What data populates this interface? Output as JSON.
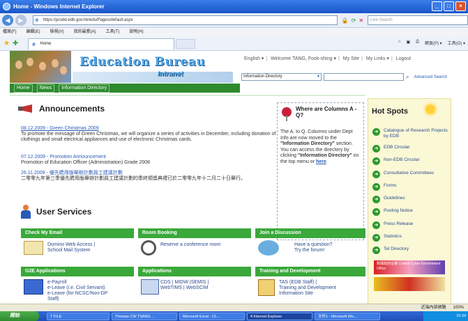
{
  "window": {
    "title": "Home - Windows Internet Explorer",
    "address": "https://pcsbd.edb.gov.hk/edu/Pages/default.aspx",
    "live_search": "Live Search",
    "tab_label": "Home"
  },
  "menu": [
    "檔案(F)",
    "編輯(E)",
    "檢視(V)",
    "我的最愛(A)",
    "工具(T)",
    "說明(H)"
  ],
  "command_bar": [
    "網頁(P) ▾",
    "工具(O) ▾"
  ],
  "site": {
    "title_line1": "Education Bureau",
    "title_line2": "Intranet",
    "nav_tabs": [
      "Home",
      "News",
      "Information Directory"
    ],
    "top_links": [
      "English ▾",
      "Welcome TANG, Fook-shing ▾",
      "My Site",
      "My Links ▾",
      "Logout"
    ],
    "search_scope": "Information Directory",
    "advanced_search": "Advanced Search"
  },
  "announcements": {
    "heading": "Announcements",
    "items": [
      {
        "date_title": "08.12.2009 - Green Christmas 2009",
        "body": "To promote the message of Green Christmas, we will organize a series of activities in December, including donation of clothings and small electrical appliances and use of electronic Christmas cards."
      },
      {
        "date_title": "07.12.2009 - Promotion Announcement",
        "body": "Promotion of Education Officer (Administration) Grade 2008"
      },
      {
        "date_title": "26.11.2009 - 優先聘用版舉辦計劃員工建議計劃",
        "body": "二零零九年第三季優先聘用版舉辦計劃員工建議計劃的季終頒獎典禮已於二零零九年十二月二十日舉行。"
      }
    ]
  },
  "where_are": {
    "heading": "Where are Columns A - Q?",
    "text1": "The A. to Q. Columns under Dept Info are now moved to the ",
    "bold1": "\"Information Directory\"",
    "text2": " section. You can access the directory by clicking ",
    "bold2": "\"Information Directory\"",
    "text3": " on the top menu or ",
    "link": "here",
    "text4": "."
  },
  "hot_spots": {
    "heading": "Hot Spots",
    "items": [
      "Catalogue of Research Projects by EDB",
      "EDB Circular",
      "Non-EDB Circular",
      "Consultative Committees",
      "Forms",
      "Guidelines",
      "Posting Notice",
      "Press Release",
      "Statistics",
      "Tel Directory"
    ],
    "banner_text": "數碼政府合署 Central Cyber Government Office"
  },
  "user_services": {
    "heading": "User Services",
    "sections": [
      {
        "title": "Check My Email",
        "lines": [
          "Domino Web Access |",
          "School Mail System"
        ]
      },
      {
        "title": "Room Booking",
        "lines": [
          "Reserve a conference room"
        ]
      },
      {
        "title": "Join a Discussion",
        "lines": [
          "Have a question?",
          "Try the forum!"
        ]
      },
      {
        "title": "G2E Applications",
        "lines": [
          "e-Payroll",
          "e-Leave (i.e. Civil Servant)",
          "e-Leave (for NCSC/Non-DP",
          "Staff)"
        ]
      },
      {
        "title": "Applications",
        "lines": [
          "CDS | MIDW |SEMIS |",
          "WebTIMS | WebSCIM"
        ]
      },
      {
        "title": "Training and Development",
        "lines": [
          "TAS (EDB Staff) |",
          "Training and Development",
          "Information Site"
        ]
      }
    ]
  },
  "status_bar": {
    "zone": "近端內部網路",
    "zoom": "100%"
  },
  "taskbar": {
    "start": "開始",
    "tasks": [
      "T FILE",
      "Thomas CW TSANG ...",
      "Microsoft Excel - CL...",
      "4 Internet Explorer",
      "文件1 - Microsoft Wo..."
    ],
    "clock": "15:34"
  },
  "colors": {
    "ie_blue": "#1a55c9",
    "edb_green": "#3aa83a",
    "link_blue": "#2a5ab8",
    "hotspot_bg": "#fbf8d6"
  }
}
